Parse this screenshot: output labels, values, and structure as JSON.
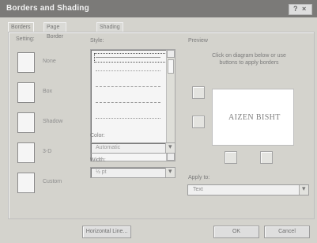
{
  "window": {
    "title": "Borders and Shading",
    "title_buttons": "?X"
  },
  "tabs": [
    {
      "label": "Borders"
    },
    {
      "label": "Page Border"
    },
    {
      "label": "Shading"
    }
  ],
  "setting": {
    "label": "Setting:",
    "items": [
      "None",
      "Box",
      "Shadow",
      "3-D",
      "Custom"
    ]
  },
  "style": {
    "label": "Style:"
  },
  "color": {
    "label": "Color:",
    "value": "Automatic"
  },
  "width": {
    "label": "Width:",
    "value": "½ pt"
  },
  "preview": {
    "label": "Preview",
    "hint": "Click on diagram below or use buttons to apply borders",
    "text": "AIZEN BISHT"
  },
  "apply_to": {
    "label": "Apply to:",
    "value": "Text"
  },
  "buttons": {
    "horizontal_line": "Horizontal Line...",
    "ok": "OK",
    "cancel": "Cancel"
  }
}
